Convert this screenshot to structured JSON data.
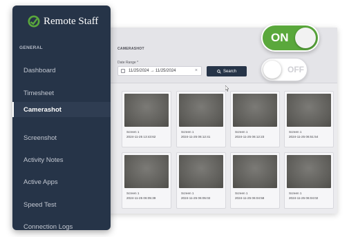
{
  "brand": {
    "name": "Remote Staff",
    "accent": "#5aa83c",
    "sidebar_bg": "#263448"
  },
  "sidebar": {
    "group_label": "GENERAL",
    "items": [
      {
        "label": "Dashboard",
        "active": false
      },
      {
        "label": "Timesheet",
        "active": false
      },
      {
        "label": "Camerashot",
        "active": true
      },
      {
        "label": "Screenshot",
        "active": false
      },
      {
        "label": "Activity Notes",
        "active": false
      },
      {
        "label": "Active Apps",
        "active": false
      },
      {
        "label": "Speed Test",
        "active": false
      },
      {
        "label": "Connection Logs",
        "active": false
      }
    ]
  },
  "main": {
    "section_title": "CAMERASHOT",
    "date_range": {
      "label": "Date Range *",
      "value": "11/25/2024 → 11/25/2024",
      "clear_icon": "close-icon",
      "calendar_icon": "calendar-icon"
    },
    "search_button": {
      "label": "Search",
      "icon": "search-icon"
    },
    "shots": [
      {
        "screen": "Screen 1",
        "time": "2024-11-25 13:43:62"
      },
      {
        "screen": "Screen 1",
        "time": "2024-11-25 06:12:41"
      },
      {
        "screen": "Screen 1",
        "time": "2024-11-25 06:12:23"
      },
      {
        "screen": "Screen 1",
        "time": "2024-11-25 06:51:54"
      },
      {
        "screen": "Screen 1",
        "time": "2024-11-25 06:05:39"
      },
      {
        "screen": "Screen 1",
        "time": "2024-11-25 06:05:02"
      },
      {
        "screen": "Screen 1",
        "time": "2024-11-25 06:04:58"
      },
      {
        "screen": "Screen 1",
        "time": "2024-11-25 06:04:02"
      }
    ]
  },
  "toggles": {
    "on_label": "ON",
    "off_label": "OFF"
  }
}
